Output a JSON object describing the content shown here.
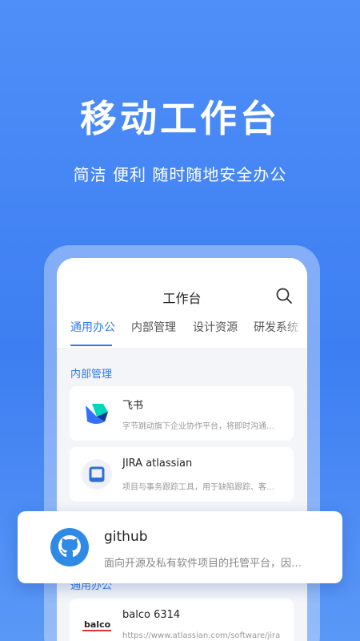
{
  "hero": {
    "title": "移动工作台",
    "subtitle": "简洁 便利 随时随地安全办公"
  },
  "app": {
    "title": "工作台",
    "tabs": [
      {
        "label": "通用办公",
        "active": true
      },
      {
        "label": "内部管理",
        "active": false
      },
      {
        "label": "设计资源",
        "active": false
      },
      {
        "label": "研发系统",
        "active": false
      }
    ],
    "sections": [
      {
        "title": "内部管理"
      },
      {
        "title": "通用办公"
      }
    ],
    "cards": [
      {
        "name": "飞书",
        "desc": "字节跳动旗下企业协作平台，将即时沟通…",
        "icon": "feishu-logo-icon"
      },
      {
        "name": "JIRA atlassian",
        "desc": "项目与事务跟踪工具，用于缺陷跟踪、客…",
        "icon": "jira-logo-icon"
      },
      {
        "name": "balco 6314",
        "desc": "https://www.atlassian.com/software/jira",
        "icon": "balco-logo-icon"
      }
    ],
    "featured": {
      "name": "github",
      "desc": "面向开源及私有软件项目的托管平台，因…",
      "icon": "github-logo-icon"
    }
  },
  "colors": {
    "accent": "#2f7bf2",
    "background": "#3d7ef2"
  }
}
